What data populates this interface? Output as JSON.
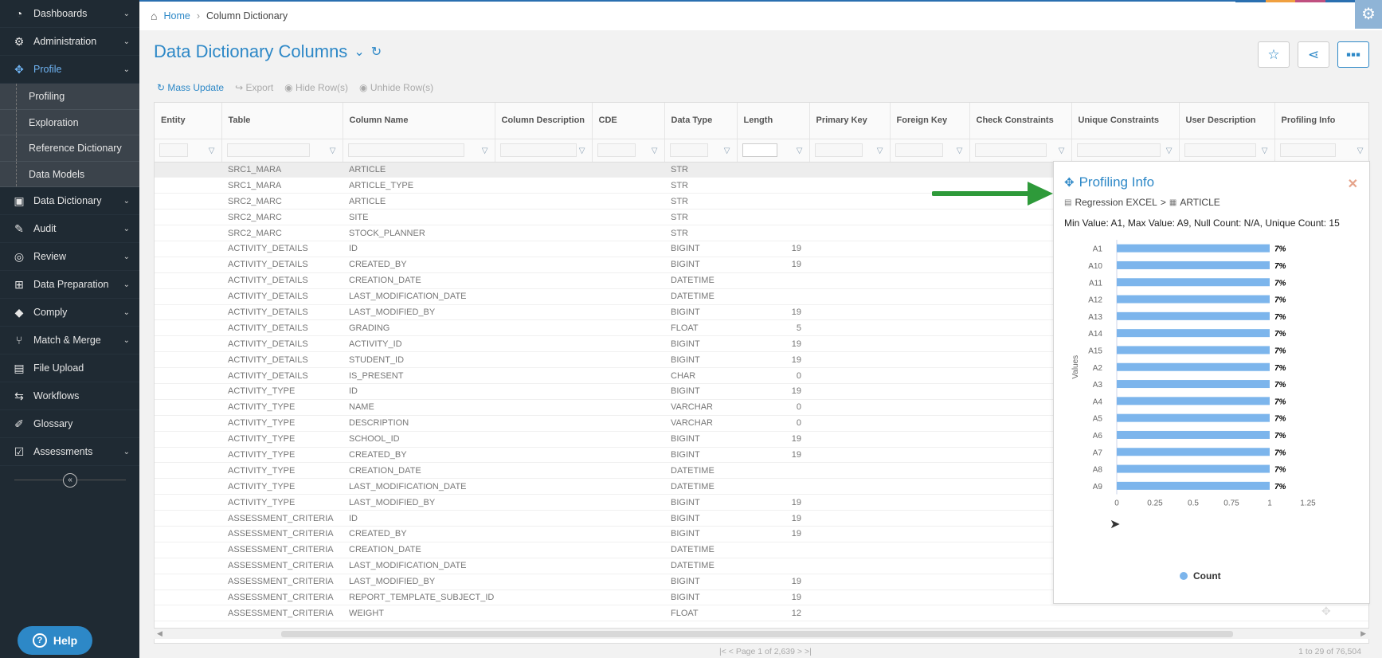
{
  "sidebar": {
    "items": [
      {
        "label": "Dashboards",
        "icon": "dashboard-icon",
        "glyph": "◔",
        "chevron": true,
        "active": false
      },
      {
        "label": "Administration",
        "icon": "cogs-icon",
        "glyph": "⚙",
        "chevron": true,
        "active": false
      },
      {
        "label": "Profile",
        "icon": "profile-icon",
        "glyph": "✥",
        "chevron": true,
        "active": true
      }
    ],
    "subitems": [
      "Profiling",
      "Exploration",
      "Reference Dictionary",
      "Data Models"
    ],
    "items_after": [
      {
        "label": "Data Dictionary",
        "icon": "book-icon",
        "glyph": "▣",
        "chevron": true
      },
      {
        "label": "Audit",
        "icon": "audit-icon",
        "glyph": "✎",
        "chevron": true
      },
      {
        "label": "Review",
        "icon": "review-icon",
        "glyph": "◎",
        "chevron": true
      },
      {
        "label": "Data Preparation",
        "icon": "data-prep-icon",
        "glyph": "⊞",
        "chevron": true
      },
      {
        "label": "Comply",
        "icon": "tag-icon",
        "glyph": "◆",
        "chevron": true
      },
      {
        "label": "Match & Merge",
        "icon": "merge-icon",
        "glyph": "⑂",
        "chevron": true
      },
      {
        "label": "File Upload",
        "icon": "file-upload-icon",
        "glyph": "▤",
        "chevron": false
      },
      {
        "label": "Workflows",
        "icon": "workflow-icon",
        "glyph": "⇆",
        "chevron": false
      },
      {
        "label": "Glossary",
        "icon": "glossary-icon",
        "glyph": "✐",
        "chevron": false
      },
      {
        "label": "Assessments",
        "icon": "assessment-icon",
        "glyph": "☑",
        "chevron": true
      }
    ],
    "help_label": "Help"
  },
  "breadcrumb": {
    "home": "Home",
    "current": "Column Dictionary"
  },
  "page": {
    "title": "Data Dictionary Columns"
  },
  "toolbar": {
    "mass_update": "Mass Update",
    "export": "Export",
    "hide_rows": "Hide Row(s)",
    "unhide_rows": "Unhide Row(s)"
  },
  "columns": [
    "Entity",
    "Table",
    "Column Name",
    "Column Description",
    "CDE",
    "Data Type",
    "Length",
    "Primary Key",
    "Foreign Key",
    "Check Constraints",
    "Unique Constraints",
    "User Description",
    "Profiling Info"
  ],
  "rows": [
    [
      "SRC1_MARA",
      "ARTICLE",
      "STR",
      ""
    ],
    [
      "SRC1_MARA",
      "ARTICLE_TYPE",
      "STR",
      ""
    ],
    [
      "SRC2_MARC",
      "ARTICLE",
      "STR",
      ""
    ],
    [
      "SRC2_MARC",
      "SITE",
      "STR",
      ""
    ],
    [
      "SRC2_MARC",
      "STOCK_PLANNER",
      "STR",
      ""
    ],
    [
      "ACTIVITY_DETAILS",
      "ID",
      "BIGINT",
      "19"
    ],
    [
      "ACTIVITY_DETAILS",
      "CREATED_BY",
      "BIGINT",
      "19"
    ],
    [
      "ACTIVITY_DETAILS",
      "CREATION_DATE",
      "DATETIME",
      ""
    ],
    [
      "ACTIVITY_DETAILS",
      "LAST_MODIFICATION_DATE",
      "DATETIME",
      ""
    ],
    [
      "ACTIVITY_DETAILS",
      "LAST_MODIFIED_BY",
      "BIGINT",
      "19"
    ],
    [
      "ACTIVITY_DETAILS",
      "GRADING",
      "FLOAT",
      "5"
    ],
    [
      "ACTIVITY_DETAILS",
      "ACTIVITY_ID",
      "BIGINT",
      "19"
    ],
    [
      "ACTIVITY_DETAILS",
      "STUDENT_ID",
      "BIGINT",
      "19"
    ],
    [
      "ACTIVITY_DETAILS",
      "IS_PRESENT",
      "CHAR",
      "0"
    ],
    [
      "ACTIVITY_TYPE",
      "ID",
      "BIGINT",
      "19"
    ],
    [
      "ACTIVITY_TYPE",
      "NAME",
      "VARCHAR",
      "0"
    ],
    [
      "ACTIVITY_TYPE",
      "DESCRIPTION",
      "VARCHAR",
      "0"
    ],
    [
      "ACTIVITY_TYPE",
      "SCHOOL_ID",
      "BIGINT",
      "19"
    ],
    [
      "ACTIVITY_TYPE",
      "CREATED_BY",
      "BIGINT",
      "19"
    ],
    [
      "ACTIVITY_TYPE",
      "CREATION_DATE",
      "DATETIME",
      ""
    ],
    [
      "ACTIVITY_TYPE",
      "LAST_MODIFICATION_DATE",
      "DATETIME",
      ""
    ],
    [
      "ACTIVITY_TYPE",
      "LAST_MODIFIED_BY",
      "BIGINT",
      "19"
    ],
    [
      "ASSESSMENT_CRITERIA",
      "ID",
      "BIGINT",
      "19"
    ],
    [
      "ASSESSMENT_CRITERIA",
      "CREATED_BY",
      "BIGINT",
      "19"
    ],
    [
      "ASSESSMENT_CRITERIA",
      "CREATION_DATE",
      "DATETIME",
      ""
    ],
    [
      "ASSESSMENT_CRITERIA",
      "LAST_MODIFICATION_DATE",
      "DATETIME",
      ""
    ],
    [
      "ASSESSMENT_CRITERIA",
      "LAST_MODIFIED_BY",
      "BIGINT",
      "19"
    ],
    [
      "ASSESSMENT_CRITERIA",
      "REPORT_TEMPLATE_SUBJECT_ID",
      "BIGINT",
      "19"
    ],
    [
      "ASSESSMENT_CRITERIA",
      "WEIGHT",
      "FLOAT",
      "12"
    ]
  ],
  "pager": {
    "page_text": "Page 1 of 2,639",
    "range_text": "1 to 29 of 76,504"
  },
  "profiling": {
    "title": "Profiling Info",
    "source": "Regression EXCEL",
    "path_sep": ">",
    "table": "ARTICLE",
    "stats": "Min Value: A1, Max Value: A9, Null Count: N/A, Unique Count: 15"
  },
  "chart_data": {
    "type": "bar",
    "orientation": "horizontal",
    "ylabel": "Values",
    "categories": [
      "A1",
      "A10",
      "A11",
      "A12",
      "A13",
      "A14",
      "A15",
      "A2",
      "A3",
      "A4",
      "A5",
      "A6",
      "A7",
      "A8",
      "A9"
    ],
    "series": [
      {
        "name": "Count",
        "values": [
          1,
          1,
          1,
          1,
          1,
          1,
          1,
          1,
          1,
          1,
          1,
          1,
          1,
          1,
          1
        ]
      }
    ],
    "data_labels": [
      "7%",
      "7%",
      "7%",
      "7%",
      "7%",
      "7%",
      "7%",
      "7%",
      "7%",
      "7%",
      "7%",
      "7%",
      "7%",
      "7%",
      "7%"
    ],
    "x_ticks": [
      "0",
      "0.25",
      "0.5",
      "0.75",
      "1",
      "1.25"
    ],
    "xlim": [
      0,
      1.25
    ],
    "legend": "bottom",
    "color": "#7cb5ec"
  },
  "colors": {
    "accent": "#2d88c7",
    "sidebar": "#1f2a33",
    "arrow": "#2e9a3a",
    "bar": "#7cb5ec"
  }
}
